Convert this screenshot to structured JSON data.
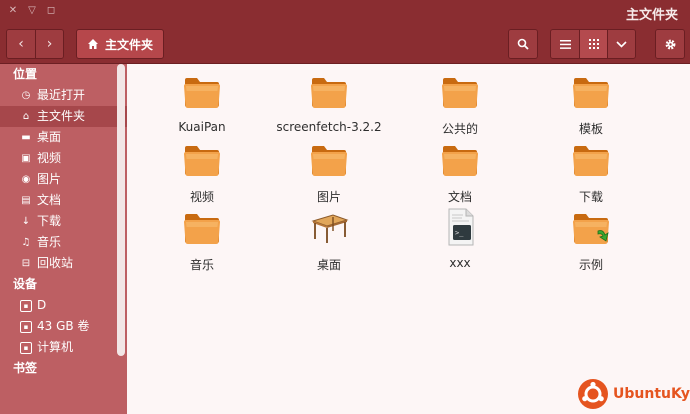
{
  "window": {
    "title": "主文件夹"
  },
  "toolbar": {
    "breadcrumb_label": "主文件夹"
  },
  "sidebar": {
    "sections": [
      {
        "label": "位置",
        "items": [
          {
            "label": "最近打开",
            "icon": "recent-icon"
          },
          {
            "label": "主文件夹",
            "icon": "home-icon",
            "selected": true
          },
          {
            "label": "桌面",
            "icon": "desktop-folder-icon"
          },
          {
            "label": "视频",
            "icon": "video-icon"
          },
          {
            "label": "图片",
            "icon": "camera-icon"
          },
          {
            "label": "文档",
            "icon": "document-icon"
          },
          {
            "label": "下载",
            "icon": "download-icon"
          },
          {
            "label": "音乐",
            "icon": "music-icon"
          },
          {
            "label": "回收站",
            "icon": "trash-icon"
          }
        ]
      },
      {
        "label": "设备",
        "items": [
          {
            "label": "D",
            "icon": "drive-icon"
          },
          {
            "label": "43 GB 卷",
            "icon": "drive-icon"
          },
          {
            "label": "计算机",
            "icon": "drive-icon"
          }
        ]
      },
      {
        "label": "书签",
        "items": []
      }
    ]
  },
  "files": [
    {
      "name": "KuaiPan",
      "type": "folder"
    },
    {
      "name": "screenfetch-3.2.2",
      "type": "folder"
    },
    {
      "name": "公共的",
      "type": "folder"
    },
    {
      "name": "模板",
      "type": "folder"
    },
    {
      "name": "视频",
      "type": "folder"
    },
    {
      "name": "图片",
      "type": "folder"
    },
    {
      "name": "文档",
      "type": "folder"
    },
    {
      "name": "下载",
      "type": "folder"
    },
    {
      "name": "音乐",
      "type": "folder"
    },
    {
      "name": "桌面",
      "type": "desktop"
    },
    {
      "name": "xxx",
      "type": "script"
    },
    {
      "name": "示例",
      "type": "folder-link"
    }
  ],
  "watermark": {
    "text": "UbuntuKylin"
  },
  "colors": {
    "titlebar": "#8a2d31",
    "sidebar": "#bd5f63",
    "accent": "#e5541f"
  }
}
